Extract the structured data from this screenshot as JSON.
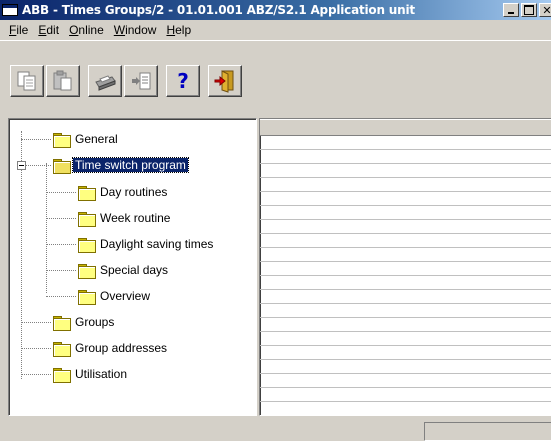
{
  "window": {
    "title": "ABB - Times Groups/2 - 01.01.001 ABZ/S2.1 Application unit",
    "close_glyph": "✕"
  },
  "menu": [
    {
      "label": "File",
      "mnemonic": "F",
      "rest": "ile"
    },
    {
      "label": "Edit",
      "mnemonic": "E",
      "rest": "dit"
    },
    {
      "label": "Online",
      "mnemonic": "O",
      "rest": "nline"
    },
    {
      "label": "Window",
      "mnemonic": "W",
      "rest": "indow"
    },
    {
      "label": "Help",
      "mnemonic": "H",
      "rest": "elp"
    }
  ],
  "toolbar": {
    "buttons": [
      {
        "name": "copy-button",
        "icon": "copy-icon"
      },
      {
        "name": "paste-button",
        "icon": "paste-icon"
      },
      {
        "name": "print-button",
        "icon": "printer-icon"
      },
      {
        "name": "export-button",
        "icon": "export-icon"
      },
      {
        "name": "help-button",
        "icon": "question-icon",
        "glyph": "?"
      },
      {
        "name": "exit-button",
        "icon": "exit-door-icon"
      }
    ]
  },
  "tree": {
    "items": [
      {
        "label": "General",
        "level": 0
      },
      {
        "label": "Time switch program",
        "level": 0,
        "expanded": true,
        "selected": true
      },
      {
        "label": "Day routines",
        "level": 1
      },
      {
        "label": "Week routine",
        "level": 1
      },
      {
        "label": "Daylight saving times",
        "level": 1
      },
      {
        "label": "Special days",
        "level": 1
      },
      {
        "label": "Overview",
        "level": 1
      },
      {
        "label": "Groups",
        "level": 0
      },
      {
        "label": "Group addresses",
        "level": 0
      },
      {
        "label": "Utilisation",
        "level": 0
      }
    ]
  },
  "colors": {
    "titlebar": "#0a246a",
    "selection": "#0a246a",
    "face": "#d4d0c8",
    "folder": "#ffff80"
  }
}
